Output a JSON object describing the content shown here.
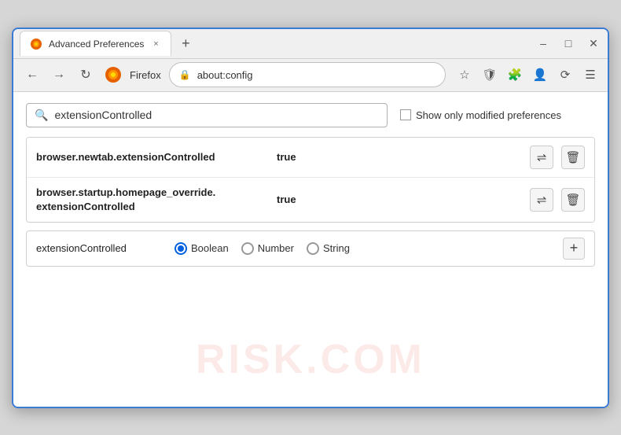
{
  "window": {
    "title": "Advanced Preferences",
    "tab_label": "Advanced Preferences",
    "close_label": "×",
    "new_tab_label": "+",
    "minimize_label": "–",
    "maximize_label": "□",
    "window_close_label": "✕"
  },
  "navbar": {
    "back_label": "←",
    "forward_label": "→",
    "refresh_label": "↻",
    "browser_name": "Firefox",
    "url": "about:config",
    "star_icon": "☆",
    "shield_icon": "🛡",
    "extension_icon": "🧩",
    "profile_icon": "👤",
    "sync_icon": "⟳",
    "menu_icon": "☰"
  },
  "search": {
    "placeholder": "extensionControlled",
    "show_modified_label": "Show only modified preferences"
  },
  "results": [
    {
      "name": "browser.newtab.extensionControlled",
      "value": "true"
    },
    {
      "name1": "browser.startup.homepage_override.",
      "name2": "extensionControlled",
      "value": "true"
    }
  ],
  "new_pref": {
    "name": "extensionControlled",
    "types": [
      "Boolean",
      "Number",
      "String"
    ],
    "selected_type": "Boolean",
    "add_label": "+"
  },
  "watermark": "RISK.COM",
  "actions": {
    "swap_label": "⇌",
    "delete_label": "🗑"
  }
}
